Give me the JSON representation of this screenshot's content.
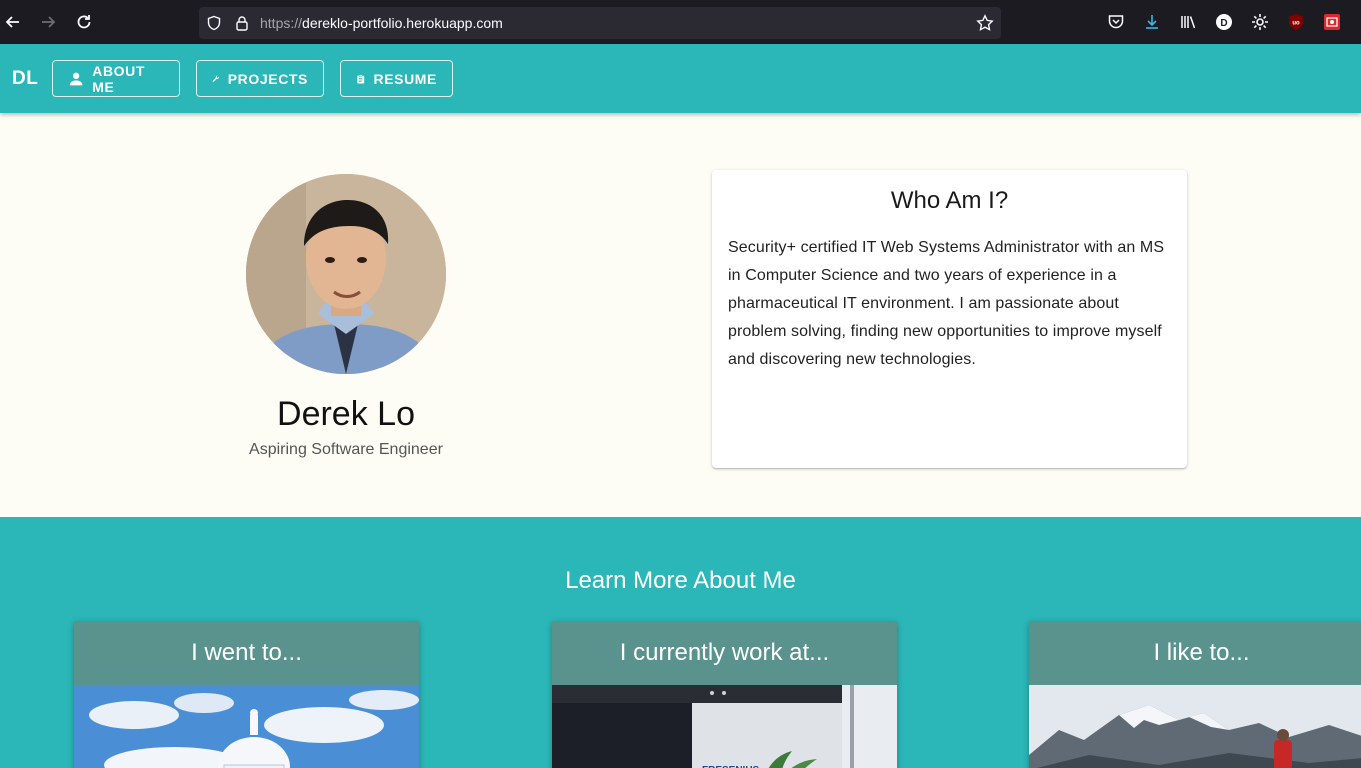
{
  "browser": {
    "url_protocol": "https://",
    "url_host": "dereklo-portfolio.herokuapp.com"
  },
  "appbar": {
    "logo": "DL",
    "buttons": [
      {
        "label": "ABOUT ME",
        "icon": "person-icon"
      },
      {
        "label": "PROJECTS",
        "icon": "wrench-icon"
      },
      {
        "label": "RESUME",
        "icon": "clipboard-icon"
      }
    ]
  },
  "profile": {
    "name": "Derek Lo",
    "tagline": "Aspiring Software Engineer"
  },
  "about": {
    "title": "Who Am I?",
    "body": "Security+ certified IT Web Systems Administrator with an MS in Computer Science and two years of experience in a pharmaceutical IT environment. I am passionate about problem solving, finding new opportunities to improve myself and discovering new technologies."
  },
  "learn_more": {
    "title": "Learn More About Me",
    "cards": [
      {
        "title": "I went to..."
      },
      {
        "title": "I currently work at..."
      },
      {
        "title": "I like to..."
      }
    ]
  },
  "colors": {
    "primary": "#2bb7b7",
    "card_header": "#5a938e",
    "background": "#fdfdf6"
  }
}
